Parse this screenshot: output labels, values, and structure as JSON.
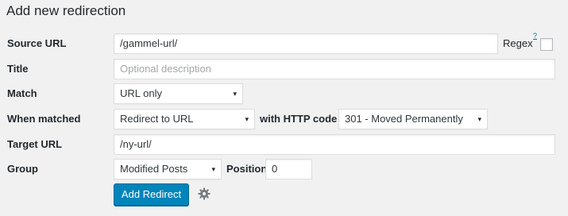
{
  "form": {
    "title": "Add new redirection",
    "source_url": {
      "label": "Source URL",
      "value": "/gammel-url/",
      "regex_label": "Regex",
      "regex_help": "?",
      "regex_checked": false
    },
    "title_field": {
      "label": "Title",
      "placeholder": "Optional description"
    },
    "match": {
      "label": "Match",
      "selected": "URL only"
    },
    "when_matched": {
      "label": "When matched",
      "selected": "Redirect to URL",
      "http_code_label": "with HTTP code",
      "http_code_selected": "301 - Moved Permanently"
    },
    "target_url": {
      "label": "Target URL",
      "value": "/ny-url/"
    },
    "group": {
      "label": "Group",
      "selected": "Modified Posts",
      "position_label": "Position",
      "position_value": "0"
    },
    "submit_label": "Add Redirect",
    "caret_icon": "▾",
    "options_icon": "gear-icon"
  }
}
